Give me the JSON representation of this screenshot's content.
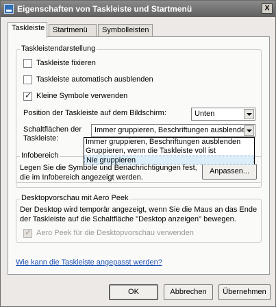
{
  "window": {
    "title": "Eigenschaften von Taskleiste und Startmenü",
    "close_label": "X"
  },
  "tabs": [
    {
      "label": "Taskleiste",
      "active": true
    },
    {
      "label": "Startmenü",
      "active": false
    },
    {
      "label": "Symbolleisten",
      "active": false
    }
  ],
  "appearance": {
    "legend": "Taskleistendarstellung",
    "lock_label": "Taskleiste fixieren",
    "lock_checked": false,
    "autohide_label": "Taskleiste automatisch ausblenden",
    "autohide_checked": false,
    "small_icons_label": "Kleine Symbole verwenden",
    "small_icons_checked": true,
    "position_label": "Position der Taskleiste auf dem Bildschirm:",
    "position_value": "Unten",
    "buttons_label_line1": "Schaltflächen der",
    "buttons_label_line2": "Taskleiste:",
    "buttons_value": "Immer gruppieren, Beschriftungen ausblenden",
    "buttons_options": [
      "Immer gruppieren, Beschriftungen ausblenden",
      "Gruppieren, wenn die Taskleiste voll ist",
      "Nie gruppieren"
    ],
    "buttons_highlighted_option": "Nie gruppieren"
  },
  "notification_area": {
    "legend": "Infobereich",
    "text_line1": "Legen Sie die Symbole und Benachrichtigungen fest,",
    "text_line2": "die im Infobereich angezeigt werden.",
    "customize_label": "Anpassen..."
  },
  "aero_peek": {
    "legend": "Desktopvorschau mit Aero Peek",
    "text_line1": "Der Desktop wird temporär angezeigt, wenn Sie die Maus an das Ende",
    "text_line2": "der Taskleiste auf die Schaltfläche \"Desktop anzeigen\" bewegen.",
    "checkbox_label": "Aero Peek für die Desktopvorschau verwenden",
    "checked": true,
    "disabled": true
  },
  "help_link": "Wie kann die Taskleiste angepasst werden?",
  "footer": {
    "ok_label": "OK",
    "cancel_label": "Abbrechen",
    "apply_label": "Übernehmen"
  }
}
